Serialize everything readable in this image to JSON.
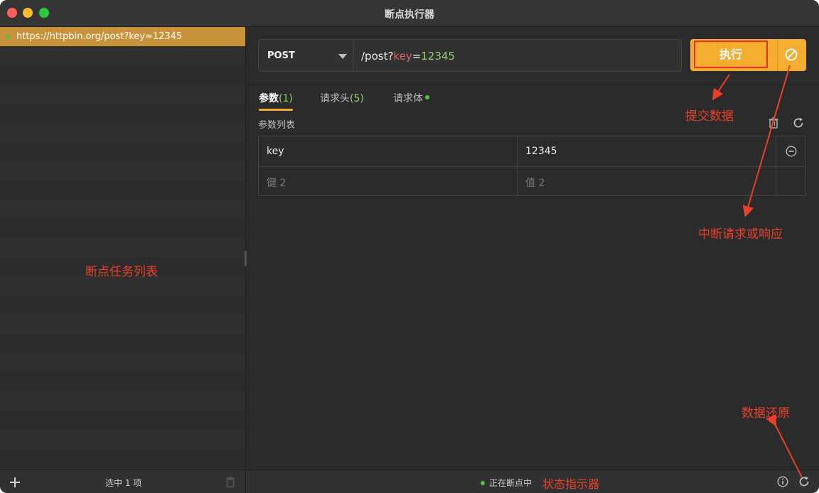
{
  "window": {
    "title": "断点执行器"
  },
  "sidebar": {
    "tasks": [
      {
        "url": "https://httpbin.org/post?key=12345"
      }
    ],
    "annotation": "断点任务列表"
  },
  "request": {
    "method": "POST",
    "url": {
      "path": "/post?",
      "key": "key",
      "eq": "=",
      "value": "12345"
    },
    "execute_label": "执行"
  },
  "tabs": [
    {
      "label": "参数",
      "count": "(1)"
    },
    {
      "label": "请求头",
      "count": "(5)"
    },
    {
      "label": "请求体"
    }
  ],
  "params": {
    "label": "参数列表",
    "rows": [
      {
        "key": "key",
        "value": "12345"
      }
    ],
    "empty_row": {
      "key_placeholder": "键 2",
      "value_placeholder": "值 2"
    }
  },
  "bottombar": {
    "selected_text": "选中 1 项",
    "status_text": "正在断点中"
  },
  "annotations": {
    "submit": "提交数据",
    "interrupt": "中断请求或响应",
    "restore": "数据还原",
    "status": "状态指示器"
  },
  "colors": {
    "accent": "#f5ad2f",
    "annotation": "#e8402b",
    "status_dot": "#54c04b",
    "param_key": "#e06262",
    "param_value": "#8fcf6e"
  },
  "icons": {
    "add": "plus-icon",
    "trash": "trash-icon",
    "info": "info-icon",
    "refresh": "refresh-icon",
    "interrupt": "ban-icon",
    "remove": "minus-circle-icon"
  }
}
